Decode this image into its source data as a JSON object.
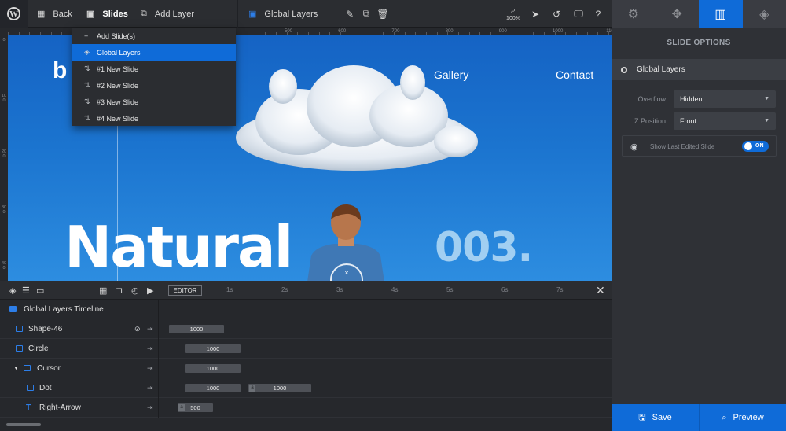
{
  "toolbar": {
    "back_label": "Back",
    "slides_label": "Slides",
    "add_layer_label": "Add Layer",
    "current_slide_label": "Global Layers",
    "zoom_label": "100%"
  },
  "slides_dropdown": {
    "items": [
      {
        "label": "Add Slide(s)",
        "icon": "plus-icon"
      },
      {
        "label": "Global Layers",
        "icon": "layers-icon",
        "active": true
      },
      {
        "label": "#1 New Slide",
        "icon": "sort-icon"
      },
      {
        "label": "#2 New Slide",
        "icon": "sort-icon"
      },
      {
        "label": "#3 New Slide",
        "icon": "sort-icon"
      },
      {
        "label": "#4 New Slide",
        "icon": "sort-icon"
      }
    ]
  },
  "ruler": {
    "top_labels": [
      "500",
      "600",
      "700",
      "800",
      "900",
      "1000",
      "1100",
      "1200"
    ],
    "left_labels": [
      "0",
      "100",
      "200",
      "300",
      "400"
    ]
  },
  "stage": {
    "logo_text": "b",
    "nav_links": [
      "Gallery",
      "Contact"
    ],
    "headline": "Natural",
    "number": "003.",
    "cursor_mark": "×"
  },
  "right_panel": {
    "tabs": [
      "gear-icon",
      "move-icon",
      "slide-icon",
      "layers-icon"
    ],
    "title": "SLIDE OPTIONS",
    "section_label": "Global Layers",
    "overflow_label": "Overflow",
    "overflow_value": "Hidden",
    "zposition_label": "Z Position",
    "zposition_value": "Front",
    "last_edited_label": "Show Last Edited Slide",
    "toggle_on_label": "ON",
    "save_label": "Save",
    "preview_label": "Preview"
  },
  "timeline": {
    "editor_label": "EDITOR",
    "ticks": [
      "1s",
      "2s",
      "3s",
      "4s",
      "5s",
      "6s",
      "7s"
    ],
    "header_label": "Global Layers Timeline",
    "layers": [
      {
        "name": "Shape-46",
        "bars": [
          {
            "value": "1000"
          }
        ]
      },
      {
        "name": "Circle",
        "bars": [
          {
            "value": "1000"
          }
        ]
      },
      {
        "name": "Cursor",
        "bars": [
          {
            "value": "1000"
          }
        ]
      },
      {
        "name": "Dot",
        "bars": [
          {
            "value": "1000"
          },
          {
            "value": "1000",
            "marker": "a"
          }
        ]
      },
      {
        "name": "Right-Arrow",
        "bars": [
          {
            "value": "500",
            "marker": "a"
          }
        ]
      }
    ]
  },
  "colors": {
    "accent": "#0f6bd8",
    "panel": "#2f3136",
    "toolbar": "#2b2d31",
    "stage_top": "#1563c4",
    "stage_bottom": "#2d8de0"
  }
}
